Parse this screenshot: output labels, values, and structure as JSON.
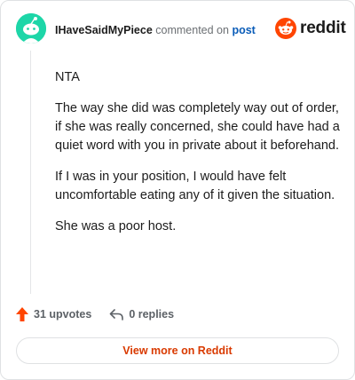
{
  "header": {
    "username": "IHaveSaidMyPiece",
    "action_text": "commented on",
    "link_text": "post"
  },
  "logo": {
    "brand": "reddit",
    "icon": "reddit-snoo-icon",
    "brand_color": "#ff4500"
  },
  "avatar": {
    "icon": "snoo-avatar-icon",
    "color": "#1dd6a8"
  },
  "comment": {
    "paragraphs": [
      "NTA",
      "The way she did was completely way out of order, if she was really concerned, she could have had a quiet word with you in private about it beforehand.",
      "If I was in your position, I would have felt uncomfortable eating any of it given the situation.",
      "She was a poor host."
    ]
  },
  "actions": {
    "upvotes": "31 upvotes",
    "upvote_icon": "upvote-arrow-icon",
    "upvote_color": "#ff4500",
    "replies": "0 replies",
    "reply_icon": "reply-arrow-icon"
  },
  "footer": {
    "view_button": "View more on Reddit",
    "accent": "#d93a00"
  }
}
